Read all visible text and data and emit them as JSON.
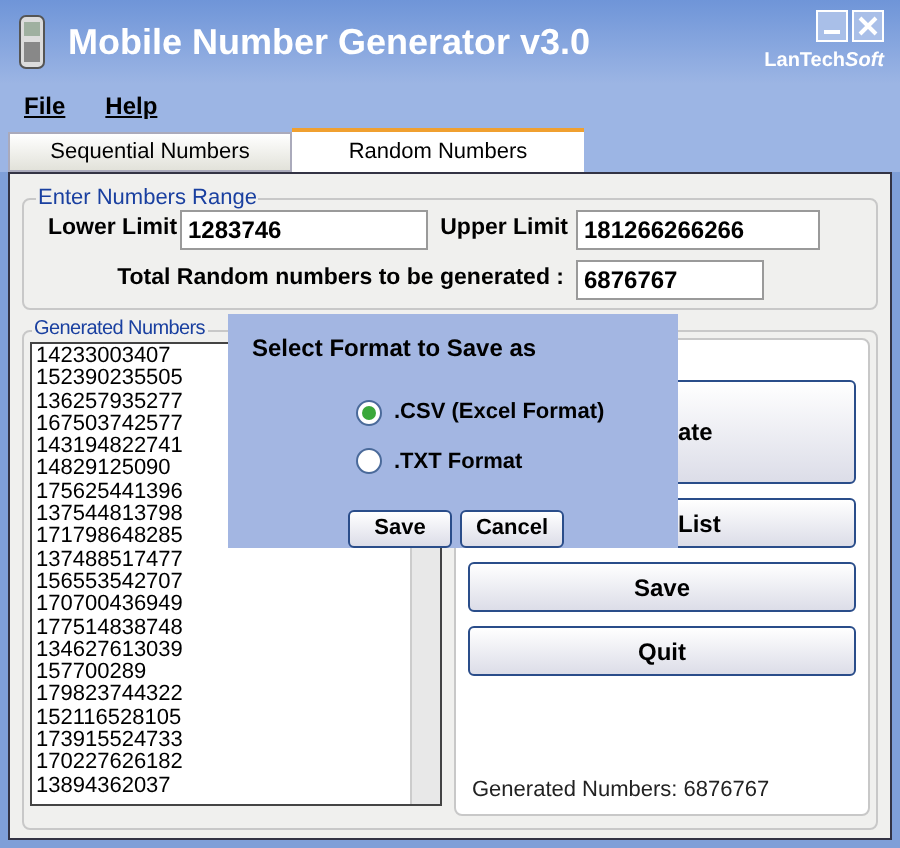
{
  "window": {
    "title": "Mobile Number Generator v3.0",
    "brand": "LanTech",
    "brand_suffix": "Soft"
  },
  "menu": [
    "File",
    "Help"
  ],
  "tabs": [
    {
      "label": "Sequential Numbers",
      "selected": false
    },
    {
      "label": "Random Numbers",
      "selected": true
    }
  ],
  "range_group": {
    "title": "Enter Numbers Range",
    "lower_label": "Lower Limit",
    "lower_value": "1283746",
    "upper_label": "Upper Limit",
    "upper_value": "181266266266",
    "total_label": "Total Random numbers to be generated :",
    "total_value": "6876767"
  },
  "list_group": {
    "title": "Generated Numbers",
    "numbers": [
      "14233003407",
      "152390235505",
      "136257935277",
      "167503742577",
      "143194822741",
      "14829125090",
      "175625441396",
      "137544813798",
      "171798648285",
      "137488517477",
      "156553542707",
      "170700436949",
      "177514838748",
      "134627613039",
      "157700289",
      "179823744322",
      "152116528105",
      "173915524733",
      "170227626182",
      "13894362037"
    ]
  },
  "actions": [
    "ate",
    "List",
    "Save",
    "Quit"
  ],
  "status": "Generated Numbers: 6876767",
  "dialog": {
    "title": "Select Format to Save as",
    "options": [
      {
        "label": ".CSV (Excel Format)",
        "selected": true
      },
      {
        "label": ".TXT Format",
        "selected": false
      }
    ],
    "buttons": [
      "Save",
      "Cancel"
    ]
  }
}
